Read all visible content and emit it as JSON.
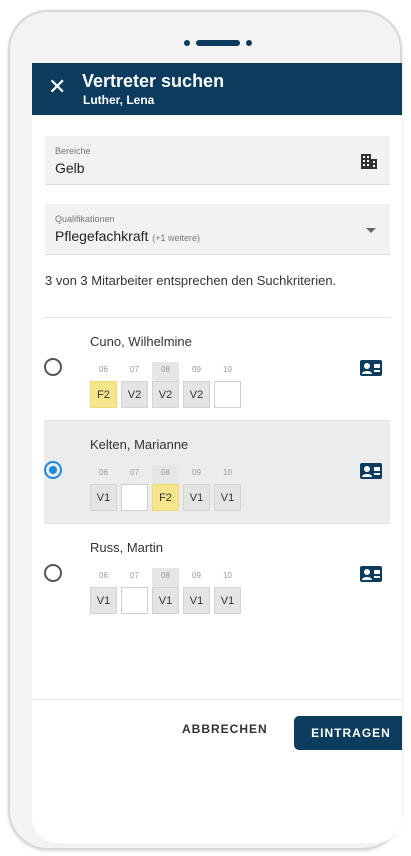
{
  "header": {
    "close_icon": "close-icon",
    "title": "Vertreter suchen",
    "subtitle": "Luther, Lena"
  },
  "filters": {
    "bereiche": {
      "label": "Bereiche",
      "value": "Gelb",
      "icon": "building-icon"
    },
    "qualifikationen": {
      "label": "Qualifikationen",
      "value": "Pflegefachkraft",
      "more": "(+1 weitere)",
      "icon": "chevron-down-icon"
    }
  },
  "summary": "3 von 3 Mitarbeiter entsprechen den Suchkriterien.",
  "days": [
    "06",
    "07",
    "08",
    "09",
    "10"
  ],
  "employees": [
    {
      "name": "Cuno, Wilhelmine",
      "selected": false,
      "shifts": [
        "F2",
        "V2",
        "V2",
        "V2",
        ""
      ]
    },
    {
      "name": "Kelten, Marianne",
      "selected": true,
      "shifts": [
        "V1",
        "",
        "F2",
        "V1",
        "V1"
      ]
    },
    {
      "name": "Russ, Martin",
      "selected": false,
      "shifts": [
        "V1",
        "",
        "V1",
        "V1",
        "V1"
      ]
    }
  ],
  "colors": {
    "primary": "#0b3c5d",
    "accent": "#1e88e5",
    "highlight": "#f6e58a"
  },
  "actions": {
    "cancel": "ABBRECHEN",
    "submit": "EINTRAGEN"
  }
}
